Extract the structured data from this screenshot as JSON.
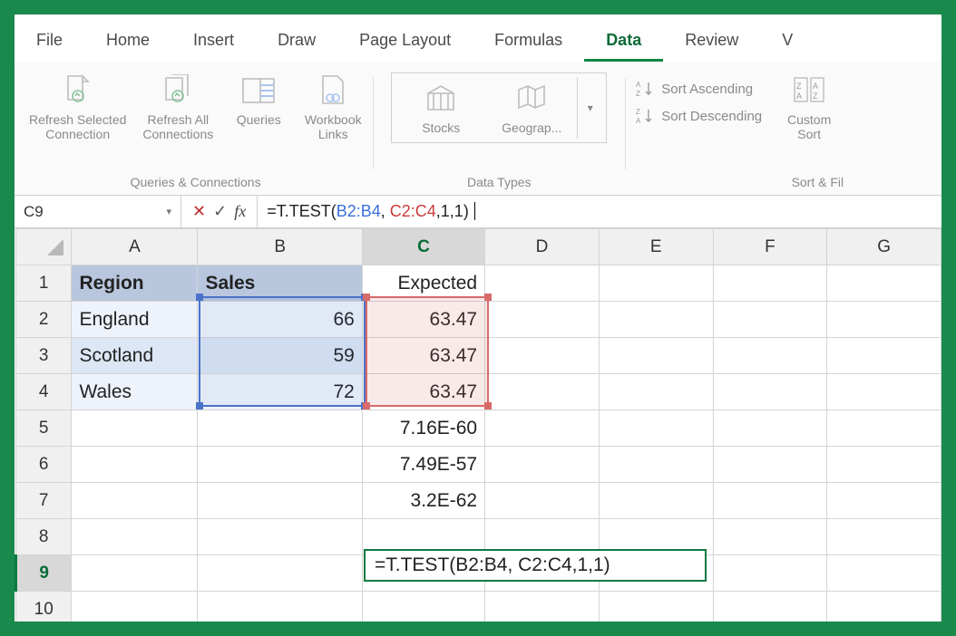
{
  "tabs": [
    "File",
    "Home",
    "Insert",
    "Draw",
    "Page Layout",
    "Formulas",
    "Data",
    "Review",
    "V"
  ],
  "activeTab": "Data",
  "ribbon": {
    "queries": {
      "refreshSelected": "Refresh Selected\nConnection",
      "refreshAll": "Refresh All\nConnections",
      "queries": "Queries",
      "workbookLinks": "Workbook\nLinks",
      "groupLabel": "Queries & Connections"
    },
    "dataTypes": {
      "stocks": "Stocks",
      "geography": "Geograp...",
      "groupLabel": "Data Types"
    },
    "sort": {
      "asc": "Sort Ascending",
      "desc": "Sort Descending",
      "custom": "Custom\nSort",
      "groupLabel": "Sort & Fil"
    }
  },
  "nameBox": "C9",
  "formula": {
    "prefix": "=T.TEST(",
    "arg1": "B2:B4",
    "sep1": ", ",
    "arg2": "C2:C4",
    "suffix": ",1,1)"
  },
  "columns": [
    "A",
    "B",
    "C",
    "D",
    "E",
    "F",
    "G"
  ],
  "rows": [
    "1",
    "2",
    "3",
    "4",
    "5",
    "6",
    "7",
    "8",
    "9",
    "10"
  ],
  "activeCell": "C9",
  "cells": {
    "A1": "Region",
    "B1": "Sales",
    "C1": "Expected",
    "A2": "England",
    "B2": "66",
    "C2": "63.47",
    "A3": "Scotland",
    "B3": "59",
    "C3": "63.47",
    "A4": "Wales",
    "B4": "72",
    "C4": "63.47",
    "C5": "7.16E-60",
    "C6": "7.49E-57",
    "C7": "3.2E-62"
  },
  "editingFormulaDisplay": "=T.TEST(B2:B4, C2:C4,1,1)",
  "chart_data": {
    "type": "table",
    "categories": [
      "England",
      "Scotland",
      "Wales"
    ],
    "series": [
      {
        "name": "Sales",
        "values": [
          66,
          59,
          72
        ]
      },
      {
        "name": "Expected",
        "values": [
          63.47,
          63.47,
          63.47
        ]
      }
    ]
  }
}
